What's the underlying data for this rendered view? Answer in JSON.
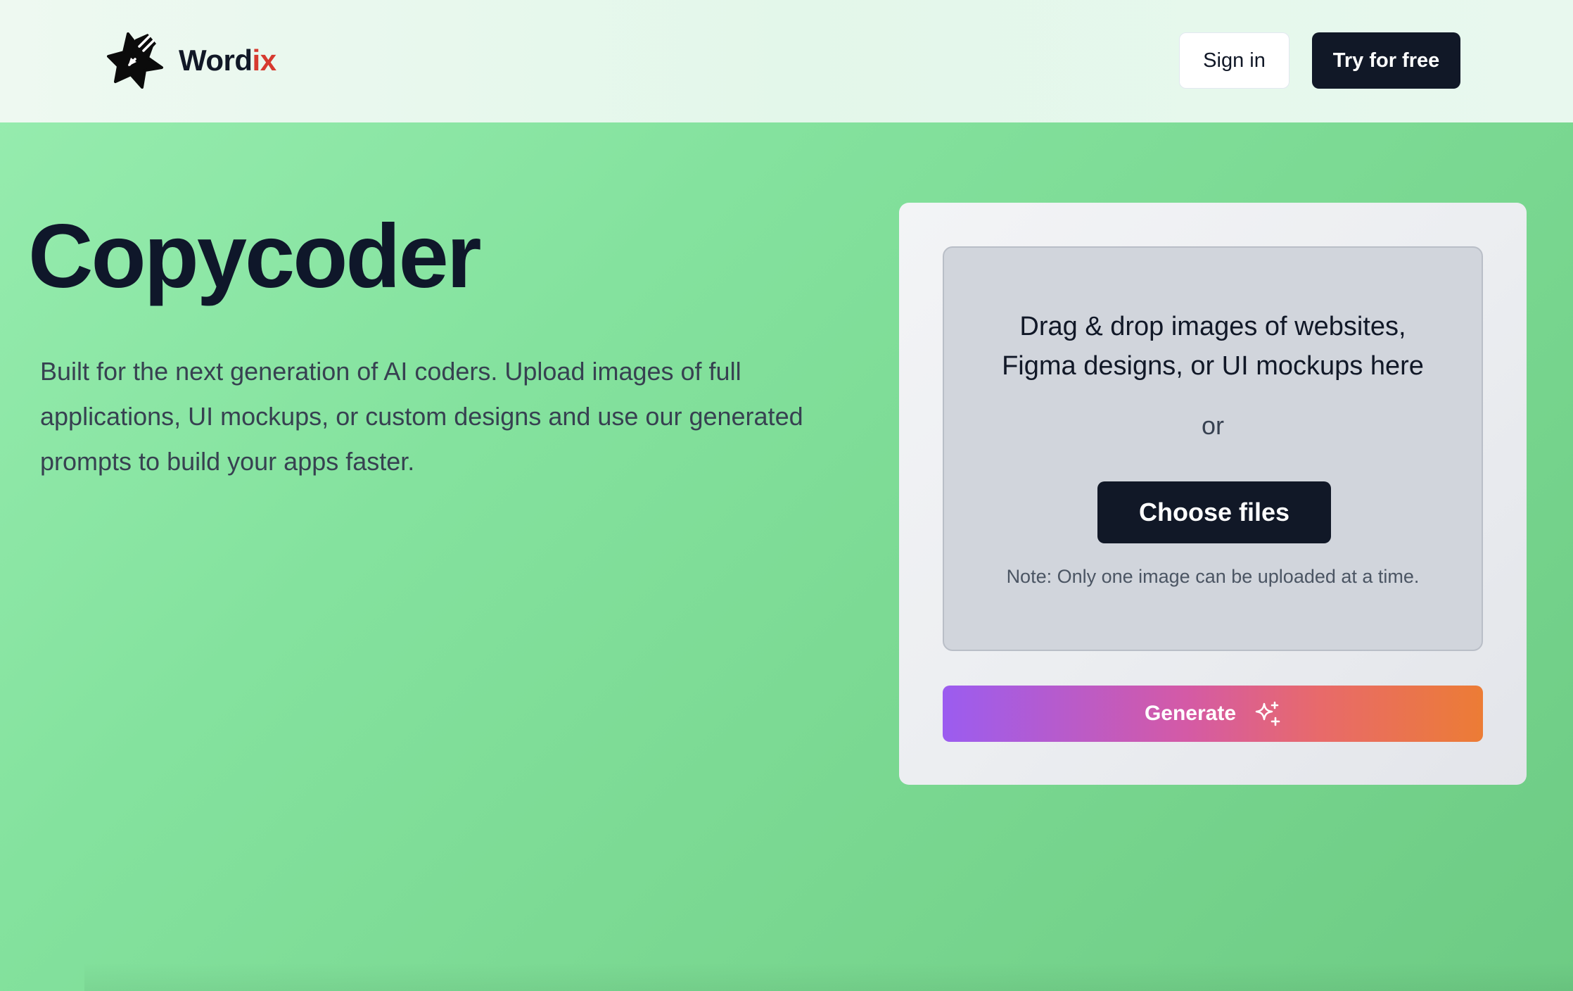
{
  "header": {
    "logo": {
      "icon": "star-pen-icon",
      "text_main": "Word",
      "text_accent": "ix",
      "accent_color": "#d63a2f"
    },
    "signin_label": "Sign in",
    "try_label": "Try for free"
  },
  "hero": {
    "title": "Copycoder",
    "description": "Built for the next generation of AI coders. Upload images of full applications, UI mockups, or custom designs and use our generated prompts to build your apps faster."
  },
  "upload": {
    "drop_text_line1": "Drag & drop images of websites,",
    "drop_text_line2": "Figma designs, or UI mockups here",
    "or_text": "or",
    "choose_label": "Choose files",
    "note": "Note: Only one image can be uploaded at a time.",
    "generate_label": "Generate",
    "generate_icon": "sparkles-icon"
  },
  "colors": {
    "background_green": "#84e29e",
    "dark_button": "#111827",
    "generate_gradient_start": "#9b5cf0",
    "generate_gradient_end": "#ec7c35"
  }
}
